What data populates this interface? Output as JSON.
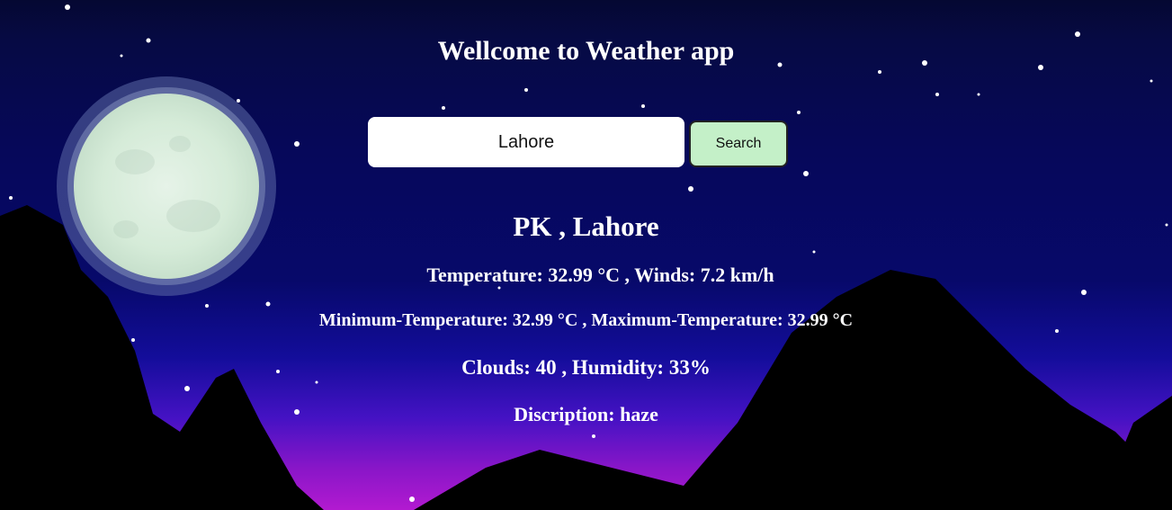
{
  "app": {
    "title": "Wellcome to Weather app"
  },
  "search": {
    "value": "Lahore",
    "button_label": "Search"
  },
  "weather": {
    "location": "PK , Lahore",
    "temp_wind": "Temperature: 32.99 °C , Winds: 7.2 km/h",
    "min_max": "Minimum-Temperature: 32.99 °C , Maximum-Temperature: 32.99 °C",
    "clouds_humidity": "Clouds: 40 , Humidity: 33%",
    "description": "Discription: haze"
  },
  "colors": {
    "sky_top": "#050832",
    "sky_mid": "#07096a",
    "horizon": "#b21ad0",
    "moon": "#dcefe0",
    "button_bg": "#c4f0c8"
  }
}
